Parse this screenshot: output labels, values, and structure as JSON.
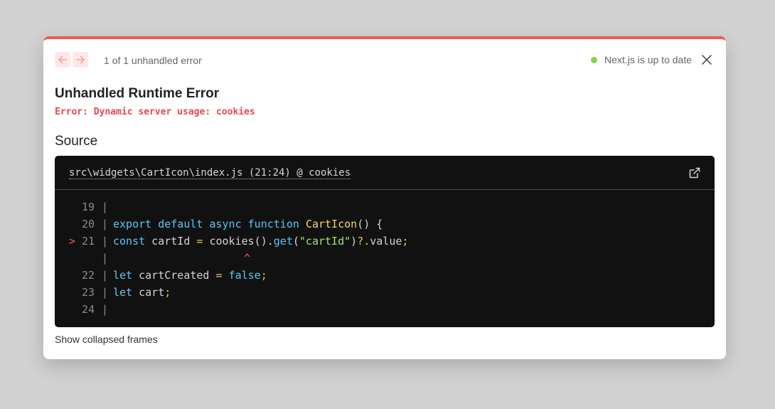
{
  "header": {
    "counter": "1 of 1 unhandled error",
    "status": "Next.js is up to date",
    "status_color": "#7fd64a"
  },
  "error": {
    "title": "Unhandled Runtime Error",
    "message": "Error: Dynamic server usage: cookies"
  },
  "source": {
    "heading": "Source",
    "file": "src\\widgets\\CartIcon\\index.js (21:24) @ cookies",
    "lines": [
      {
        "num": "19",
        "marker": "",
        "tokens": []
      },
      {
        "num": "20",
        "marker": "",
        "tokens": [
          {
            "t": "export default async function ",
            "c": "k"
          },
          {
            "t": "CartIcon",
            "c": "fn"
          },
          {
            "t": "() {",
            "c": ""
          }
        ]
      },
      {
        "num": "21",
        "marker": ">",
        "tokens": [
          {
            "t": "const",
            "c": "k"
          },
          {
            "t": " cartId ",
            "c": ""
          },
          {
            "t": "=",
            "c": "pn"
          },
          {
            "t": " cookies().",
            "c": ""
          },
          {
            "t": "get",
            "c": "k"
          },
          {
            "t": "(",
            "c": ""
          },
          {
            "t": "\"cartId\"",
            "c": "str"
          },
          {
            "t": ")",
            "c": ""
          },
          {
            "t": "?.",
            "c": "pn"
          },
          {
            "t": "value",
            "c": ""
          },
          {
            "t": ";",
            "c": "pn"
          }
        ]
      },
      {
        "num": "",
        "marker": "",
        "caret": "^",
        "tokens": []
      },
      {
        "num": "22",
        "marker": "",
        "tokens": [
          {
            "t": "let",
            "c": "k"
          },
          {
            "t": " cartCreated ",
            "c": ""
          },
          {
            "t": "=",
            "c": "pn"
          },
          {
            "t": " ",
            "c": ""
          },
          {
            "t": "false",
            "c": "k"
          },
          {
            "t": ";",
            "c": "pn"
          }
        ]
      },
      {
        "num": "23",
        "marker": "",
        "tokens": [
          {
            "t": "let",
            "c": "k"
          },
          {
            "t": " cart",
            "c": ""
          },
          {
            "t": ";",
            "c": "pn"
          }
        ]
      },
      {
        "num": "24",
        "marker": "",
        "tokens": []
      }
    ],
    "bar_char": "|"
  },
  "footer": {
    "collapsed_label": "Show collapsed frames"
  },
  "icons": {
    "prev": "arrow-left-icon",
    "next": "arrow-right-icon",
    "close": "close-icon",
    "external": "external-link-icon"
  },
  "colors": {
    "accent": "#ee5a52",
    "error_text": "#e5484d",
    "code_bg": "#111111"
  }
}
